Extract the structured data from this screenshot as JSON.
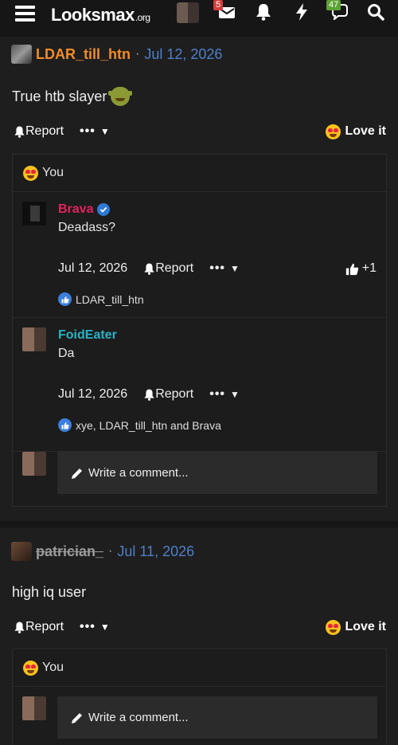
{
  "header": {
    "logo_text": "Lᴏᴏksmax",
    "logo_suffix": ".org",
    "inbox_badge": "5",
    "conversations_badge": "47",
    "icons": [
      "menu-icon",
      "inbox-icon",
      "bell-icon",
      "bolt-icon",
      "chat-icon",
      "search-icon"
    ]
  },
  "posts": [
    {
      "username": "LDAR_till_htn",
      "username_color": "#f28c28",
      "date": "Jul 12, 2026",
      "body": "True htb slayer",
      "report_label": "Report",
      "love_label": "Love it",
      "reacted_label": "You",
      "comments": [
        {
          "username": "Brava",
          "username_color": "#e0245e",
          "verified": true,
          "text": "Deadass?",
          "date": "Jul 12, 2026",
          "report_label": "Report",
          "like_count": "+1",
          "reactions": "LDAR_till_htn"
        },
        {
          "username": "FoidEater",
          "username_color": "#27b3c4",
          "verified": false,
          "text": "Da",
          "date": "Jul 12, 2026",
          "report_label": "Report",
          "reactions": "xye, LDAR_till_htn and Brava"
        }
      ],
      "write_placeholder": "Write a comment..."
    },
    {
      "username": "patrician_",
      "username_color": "#9b9b9b",
      "date": "Jul 11, 2026",
      "body": "high iq user",
      "report_label": "Report",
      "love_label": "Love it",
      "reacted_label": "You",
      "write_placeholder": "Write a comment..."
    }
  ]
}
